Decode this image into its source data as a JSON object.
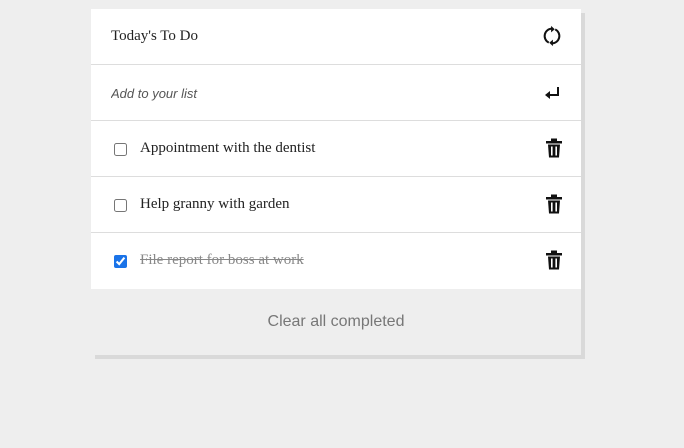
{
  "header": {
    "title": "Today's To Do",
    "refresh_icon": "refresh-icon"
  },
  "add": {
    "placeholder": "Add to your list",
    "enter_icon": "enter-icon"
  },
  "tasks": [
    {
      "label": "Appointment with the dentist",
      "completed": false
    },
    {
      "label": "Help granny with garden",
      "completed": false
    },
    {
      "label": "File report for boss at work",
      "completed": true
    }
  ],
  "footer": {
    "clear_label": "Clear all completed"
  },
  "colors": {
    "background": "#eeeeee",
    "card": "#ffffff",
    "checkbox_accent": "#1a73e8",
    "completed_text": "#888888"
  }
}
